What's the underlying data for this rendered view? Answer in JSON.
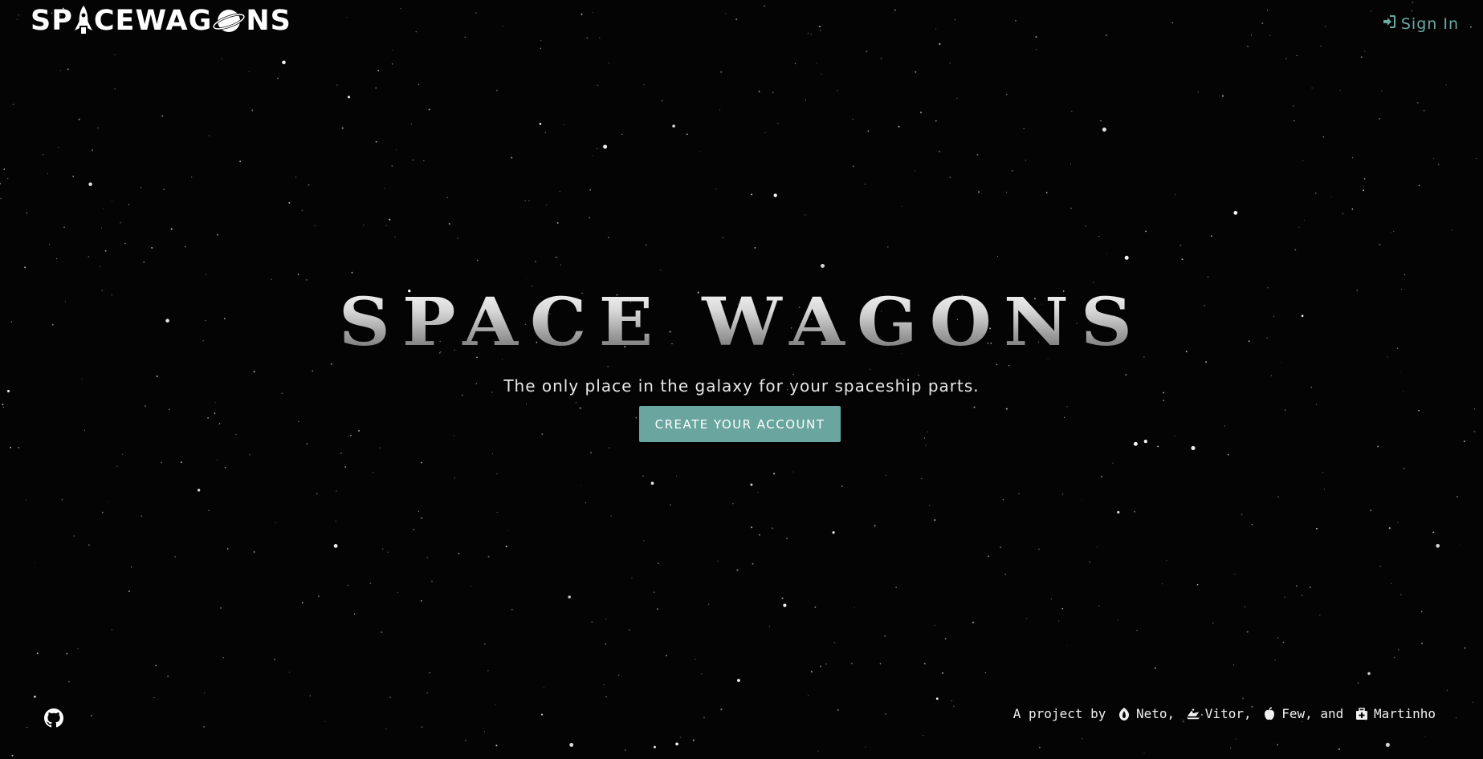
{
  "header": {
    "logo": {
      "part1": "SP",
      "part2": "CEWAG",
      "part3": "NS",
      "rocket_icon": "rocket-icon",
      "planet_icon": "planet-icon"
    },
    "sign_in": {
      "icon": "sign-in-icon",
      "label": "Sign In",
      "color": "#6aa9a4"
    }
  },
  "hero": {
    "title": "SPACE WAGONS",
    "tagline": "The only place in the galaxy for your spaceship parts.",
    "cta_label": "CREATE YOUR ACCOUNT",
    "cta_color": "#6aa5a0"
  },
  "footer": {
    "github_icon": "github-icon",
    "credits": {
      "prefix": "A project by ",
      "people": [
        {
          "icon": "rebel-icon",
          "name": "Neto",
          "sep": ", "
        },
        {
          "icon": "ship-icon",
          "name": "Vitor",
          "sep": ", "
        },
        {
          "icon": "apple-icon",
          "name": "Few",
          "sep": ", and "
        },
        {
          "icon": "medkit-icon",
          "name": "Martinho",
          "sep": ""
        }
      ]
    }
  },
  "colors": {
    "background": "#040404",
    "accent": "#6aa5a0"
  }
}
